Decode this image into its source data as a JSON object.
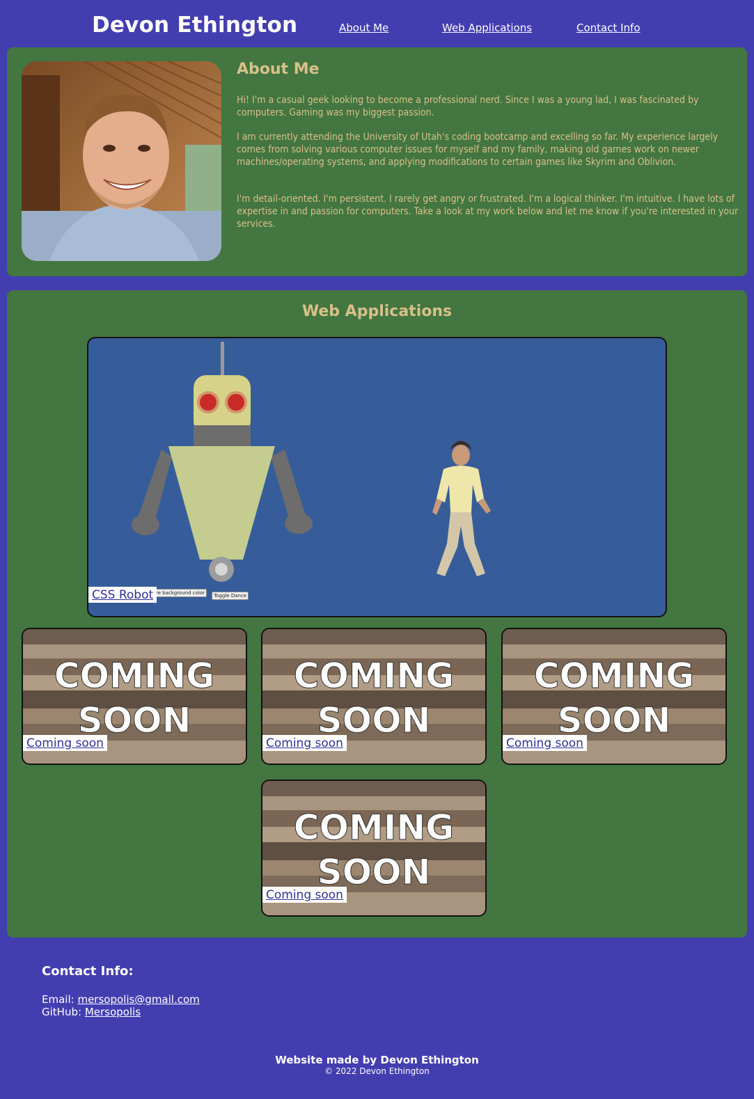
{
  "header": {
    "title": "Devon Ethington",
    "nav": [
      "About Me",
      "Web Applications",
      "Contact Info"
    ]
  },
  "about": {
    "heading": "About Me",
    "paragraphs": [
      "Hi! I'm a casual geek looking to become a professional nerd. Since I was a young lad, I was fascinated by computers. Gaming was my biggest passion.",
      "I am currently attending the University of Utah's coding bootcamp and excelling so far. My experience largely comes from solving various computer issues for myself and my family, making old games work on newer machines/operating systems, and applying modifications to certain games like Skyrim and Oblivion.",
      "I'm detail-oriented. I'm persistent. I rarely get angry or frustrated. I'm a logical thinker. I'm intuitive. I have lots of expertise in and passion for computers. Take a look at my work below and let me know if you're interested in your services."
    ]
  },
  "apps": {
    "heading": "Web Applications",
    "featured": {
      "label": "CSS Robot",
      "buttons": [
        "Randomize background color",
        "Toggle Dance"
      ]
    },
    "placeholder_image_text": [
      "COMING",
      "SOON"
    ],
    "placeholders": [
      {
        "label": "Coming soon"
      },
      {
        "label": "Coming soon"
      },
      {
        "label": "Coming soon"
      },
      {
        "label": "Coming soon"
      }
    ]
  },
  "footer": {
    "contact_heading": "Contact Info:",
    "email_label": "Email:",
    "email": "mersopolis@gmail.com",
    "github_label": "GitHub:",
    "github": "Mersopolis",
    "credit": "Website made by Devon Ethington",
    "copyright": "© 2022 Devon Ethington"
  },
  "colors": {
    "page_bg": "#433eb0",
    "panel_bg": "#437640",
    "heading_text": "#d8c08a",
    "robot_bg": "#365d99",
    "link_label": "#2f2f9a"
  }
}
